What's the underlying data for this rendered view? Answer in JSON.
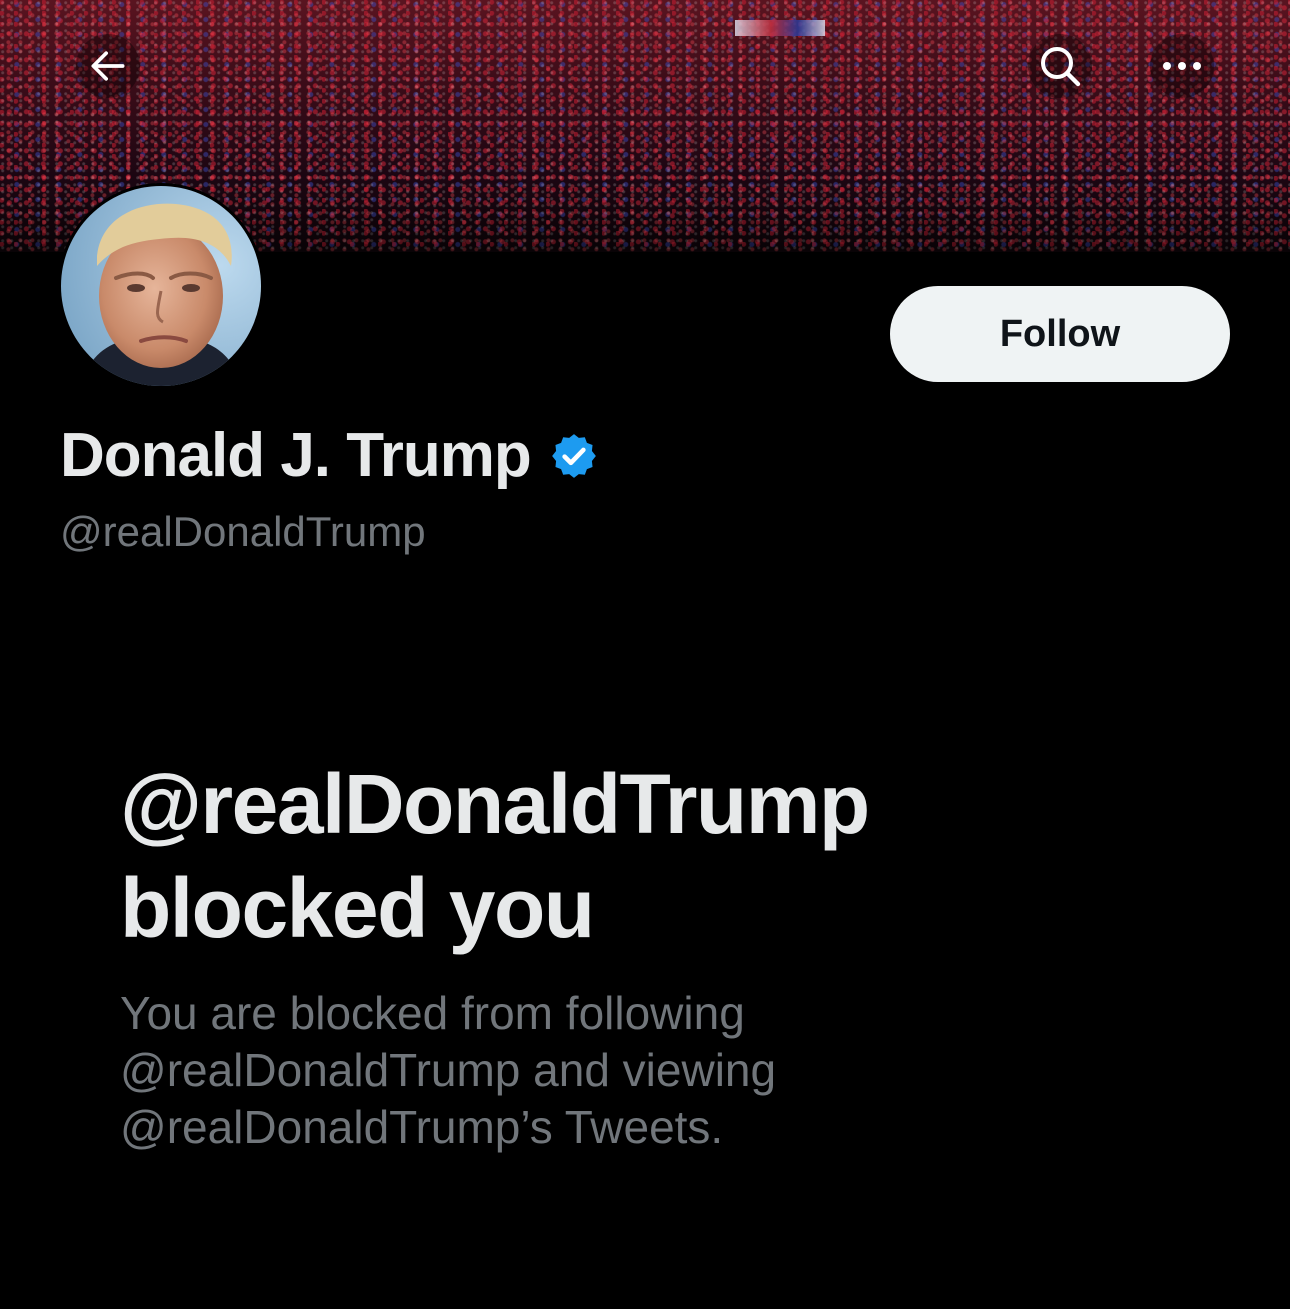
{
  "header": {
    "back_icon": "arrow-left-icon",
    "search_icon": "search-icon",
    "more_icon": "more-horizontal-icon"
  },
  "profile": {
    "display_name": "Donald J. Trump",
    "verified_icon": "verified-badge-icon",
    "verified_color": "#1d9bf0",
    "handle": "@realDonaldTrump",
    "follow_label": "Follow"
  },
  "blocked_notice": {
    "title_line1": "@realDonaldTrump",
    "title_line2": "blocked you",
    "desc_line1": "You are blocked from following",
    "desc_line2": "@realDonaldTrump and viewing",
    "desc_line3": "@realDonaldTrump’s Tweets."
  },
  "colors": {
    "background": "#000000",
    "primary_text": "#e7e9ea",
    "secondary_text": "#71767b",
    "follow_button_bg": "#eff3f4"
  }
}
